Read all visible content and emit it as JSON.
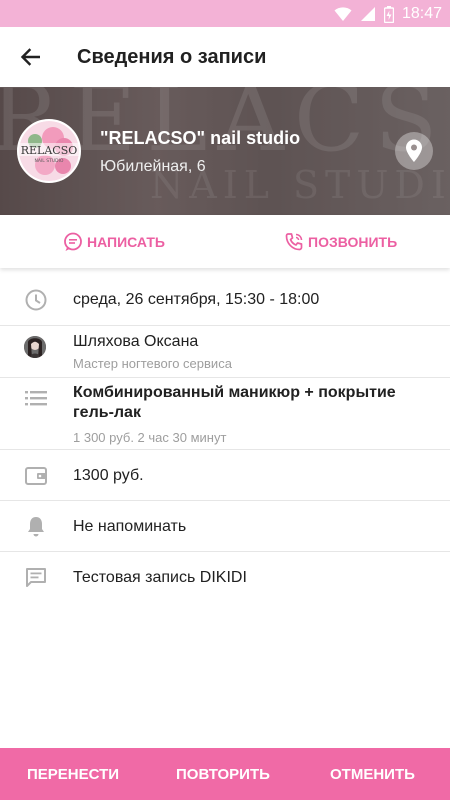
{
  "status_bar": {
    "time": "18:47"
  },
  "header": {
    "title": "Сведения о записи"
  },
  "studio": {
    "name": "\"RELACSO\" nail studio",
    "address": "Юбилейная, 6",
    "logo_text": "RELACSO",
    "logo_subtext": "NAIL STUDIO",
    "banner_text": "RELACSO",
    "banner_subtext": "NAIL STUDIO"
  },
  "actions": {
    "write": "НАПИСАТЬ",
    "call": "ПОЗВОНИТЬ"
  },
  "details": {
    "datetime": "среда, 26 сентября, 15:30 - 18:00",
    "master_name": "Шляхова Оксана",
    "master_role": "Мастер ногтевого сервиса",
    "service_name": "Комбинированный маникюр + покрытие гель-лак",
    "service_meta": "1 300 руб.  2 час 30 минут",
    "price": "1300 руб.",
    "reminder": "Не напоминать",
    "comment": "Тестовая запись DIKIDI"
  },
  "bottom_actions": {
    "reschedule": "ПЕРЕНЕСТИ",
    "repeat": "ПОВТОРИТЬ",
    "cancel": "ОТМЕНИТЬ"
  },
  "colors": {
    "accent": "#ec5fa2",
    "status_bar": "#f3b2d6",
    "bottom_bar": "#f06aa6",
    "icon_gray": "#b0b0b0"
  }
}
